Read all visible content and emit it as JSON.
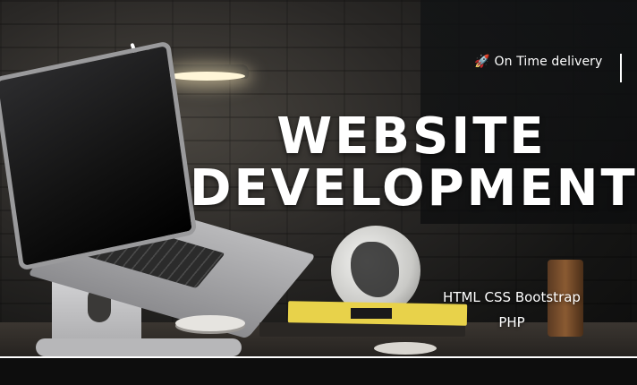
{
  "banner": {
    "tagline_icon": "rocket-icon",
    "tagline_emoji": "🚀",
    "tagline": "On Time delivery",
    "headline_line1": "WEBSITE",
    "headline_line2": "DEVELOPMENT",
    "skills_line1": "HTML CSS Bootstrap",
    "skills_line2": "PHP"
  },
  "colors": {
    "text": "#ffffff",
    "background": "#151514",
    "book": "#e8d24a"
  }
}
